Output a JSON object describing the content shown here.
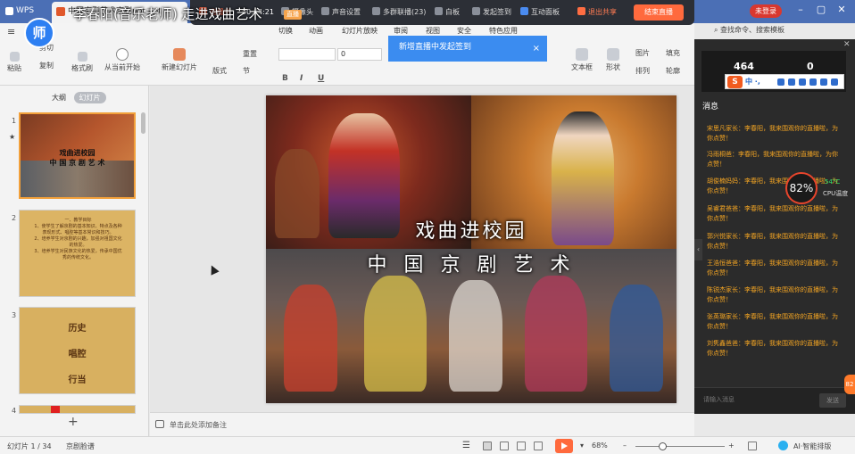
{
  "app": {
    "name": "WPS",
    "document_tab": "中国京剧艺术京剧ppt.ppt"
  },
  "window": {
    "unlogin": "未登录",
    "minimize": "–",
    "maximize": "▢",
    "close": "✕"
  },
  "livebar": {
    "status": "直播中",
    "timer": "00:04:21",
    "items": [
      "摄像头",
      "声音设置",
      "多群联播(23)",
      "白板",
      "发起签到",
      "互动面板",
      "退出共享"
    ],
    "end_label": "结束直播"
  },
  "teacher": {
    "avatar": "师",
    "name": "李春阳(音乐老师) 走进戏曲艺术",
    "badge": "直播"
  },
  "menu": [
    "切换",
    "动画",
    "幻灯片放映",
    "审阅",
    "视图",
    "安全",
    "特色应用"
  ],
  "notice": {
    "text": "新增直播中发起签到",
    "close": "×"
  },
  "search": "查找命令、搜索模板",
  "ribbon": {
    "paste": "粘贴",
    "cut": "剪切",
    "copy": "复制",
    "format_painter": "格式刷",
    "play_from_start": "从当前开始",
    "new_slide": "新建幻灯片",
    "layout": "版式",
    "section": "节",
    "reset": "重置",
    "font_size": "0",
    "textbox": "文本框",
    "shape": "形状",
    "arrange": "排列",
    "picture": "图片",
    "fill": "填充",
    "outline": "轮廓"
  },
  "panel": {
    "tabs": [
      "大纲",
      "幻灯片"
    ],
    "active_tab": 1,
    "slide_numbers": [
      "1",
      "2",
      "3",
      "4"
    ],
    "star": "★",
    "thumb1_lines": [
      "戏曲进校园",
      "中 国 京 剧 艺 术"
    ],
    "thumb2_lines": [
      "一、教学目标",
      "1、使学生了解京剧的基本知识、特点及各种表现形式、唱腔等基本常识和技巧。",
      "2、培养学生对京剧的兴趣，加强对祖国文化的热爱。",
      "3、培养学生对民族文化的热爱，传承中国优秀的传统文化。"
    ],
    "thumb3_lines": [
      "历史",
      "唱腔",
      "行当"
    ],
    "add": "+"
  },
  "slide": {
    "title": "戏曲进校园",
    "subtitle": "中 国 京 剧 艺 术"
  },
  "notes": {
    "placeholder": "单击此处添加备注"
  },
  "status": {
    "slide_info": "幻灯片 1 / 34",
    "theme": "京剧脸谱",
    "zoom": "68%",
    "zoom_minus": "–",
    "zoom_plus": "+",
    "ai": "AI·智能排版"
  },
  "chat": {
    "close": "✕",
    "count_left": "464",
    "count_right": "0",
    "ime_logo": "S",
    "ime_lang": "中 ·,",
    "title": "消息",
    "messages": [
      {
        "name": "宋思凡家长：",
        "text": "李春阳，我来围观你的直播啦，为你点赞！"
      },
      {
        "name": "冯雨桐爸：",
        "text": "李春阳，我来围观你的直播啦，为你点赞！"
      },
      {
        "name": "胡俊楠妈妈：",
        "text": "李春阳，我来围观你的直播啦，为你点赞！"
      },
      {
        "name": "吴睿君爸爸：",
        "text": "李春阳，我来围观你的直播啦，为你点赞！"
      },
      {
        "name": "郭兴悦家长：",
        "text": "李春阳，我来围观你的直播啦，为你点赞！"
      },
      {
        "name": "王浩恒爸爸：",
        "text": "李春阳，我来围观你的直播啦，为你点赞！"
      },
      {
        "name": "陈锐杰家长：",
        "text": "李春阳，我来围观你的直播啦，为你点赞！"
      },
      {
        "name": "张英璐家长：",
        "text": "李春阳，我来围观你的直播啦，为你点赞！"
      },
      {
        "name": "刘隽鑫爸爸：",
        "text": "李春阳，我来围观你的直播啦，为你点赞！"
      }
    ],
    "input_placeholder": "请输入消息",
    "send": "发送",
    "expand": "‹"
  },
  "cpu": {
    "usage": "82%",
    "temp": "54°C",
    "label": "CPU温度"
  },
  "side_tab": "82"
}
